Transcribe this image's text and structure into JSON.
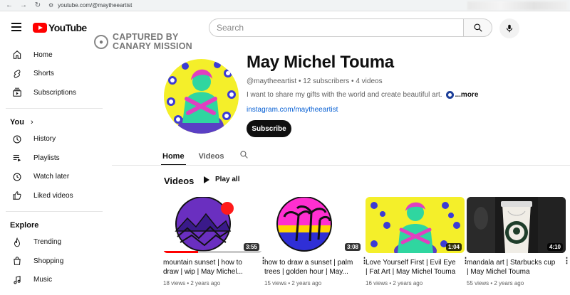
{
  "browser": {
    "url": "youtube.com/@maytheeartist"
  },
  "header": {
    "logo_text": "YouTube",
    "search_placeholder": "Search",
    "watermark_line1": "CAPTURED BY",
    "watermark_line2": "CANARY MISSION"
  },
  "sidebar": {
    "main": [
      {
        "label": "Home",
        "icon": "home-icon"
      },
      {
        "label": "Shorts",
        "icon": "shorts-icon"
      },
      {
        "label": "Subscriptions",
        "icon": "subscriptions-icon"
      }
    ],
    "you_heading": "You",
    "you": [
      {
        "label": "History",
        "icon": "history-icon"
      },
      {
        "label": "Playlists",
        "icon": "playlists-icon"
      },
      {
        "label": "Watch later",
        "icon": "watch-later-icon"
      },
      {
        "label": "Liked videos",
        "icon": "liked-videos-icon"
      }
    ],
    "explore_heading": "Explore",
    "explore": [
      {
        "label": "Trending",
        "icon": "trending-icon"
      },
      {
        "label": "Shopping",
        "icon": "shopping-icon"
      },
      {
        "label": "Music",
        "icon": "music-icon"
      }
    ]
  },
  "channel": {
    "name": "May Michel Touma",
    "meta": "@maytheeartist • 12 subscribers • 4 videos",
    "description": "I want to share my gifts with the world and create beautiful art.",
    "more": "...more",
    "link": "instagram.com/maytheeartist",
    "subscribe": "Subscribe"
  },
  "tabs": [
    "Home",
    "Videos"
  ],
  "section": {
    "title": "Videos",
    "play_all": "Play all"
  },
  "videos": [
    {
      "title": "mountain sunset | how to draw | wip | May Michel...",
      "meta": "18 views • 2 years ago",
      "duration": "3:55",
      "progress": 0.35
    },
    {
      "title": "how to draw a sunset | palm trees | golden hour | May...",
      "meta": "15 views • 2 years ago",
      "duration": "3:08"
    },
    {
      "title": "Love Yourself First | Evil Eye | Fat Art | May Michel Touma",
      "meta": "16 views • 2 years ago",
      "duration": "1:04"
    },
    {
      "title": "mandala art | Starbucks cup | May Michel Touma",
      "meta": "55 views • 2 years ago",
      "duration": "4:10"
    }
  ],
  "colors": {
    "brand": "#ff0000",
    "link": "#065fd4",
    "text": "#0f0f0f",
    "secondary": "#606060"
  }
}
